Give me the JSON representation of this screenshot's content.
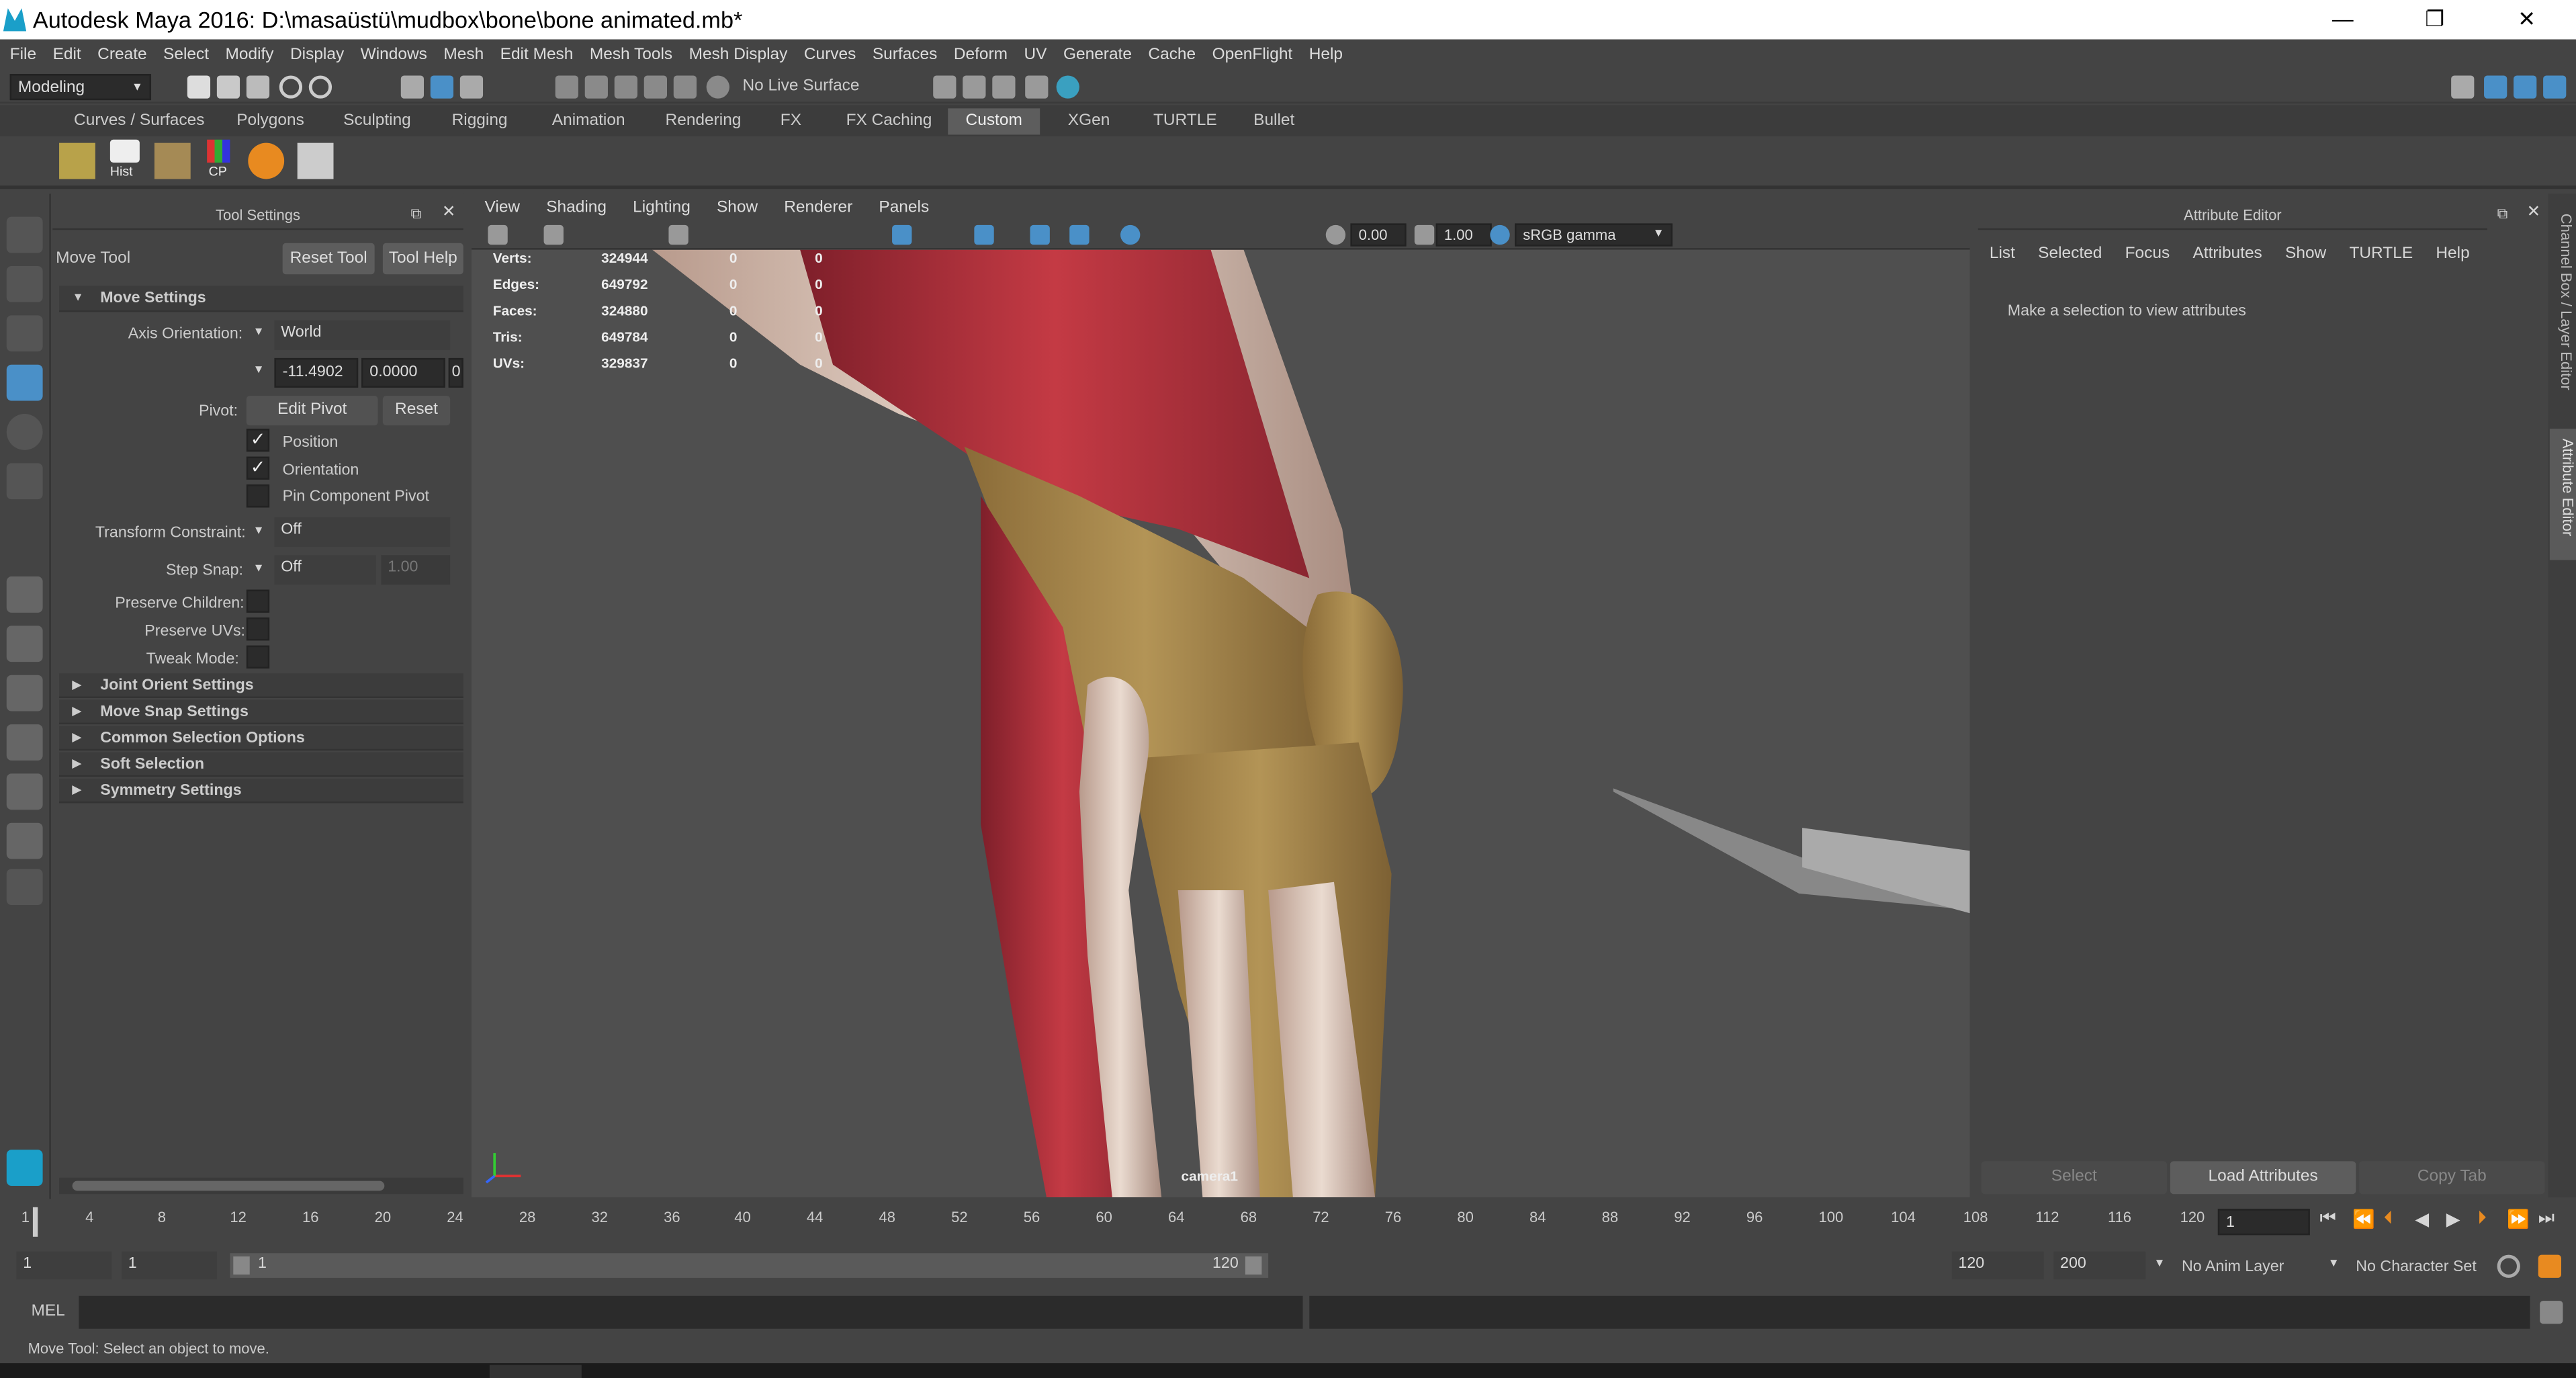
{
  "window": {
    "title": "Autodesk Maya 2016: D:\\masaüstü\\mudbox\\bone\\bone animated.mb*",
    "minimize": "—",
    "restore": "❐",
    "close": "✕"
  },
  "menubar": {
    "items": [
      "File",
      "Edit",
      "Create",
      "Select",
      "Modify",
      "Display",
      "Windows",
      "Mesh",
      "Edit Mesh",
      "Mesh Tools",
      "Mesh Display",
      "Curves",
      "Surfaces",
      "Deform",
      "UV",
      "Generate",
      "Cache",
      "OpenFlight",
      "Help"
    ]
  },
  "statusline": {
    "mode": "Modeling",
    "live_surface": "No Live Surface"
  },
  "shelf": {
    "tabs": [
      "Curves / Surfaces",
      "Polygons",
      "Sculpting",
      "Rigging",
      "Animation",
      "Rendering",
      "FX",
      "FX Caching",
      "Custom",
      "XGen",
      "TURTLE",
      "Bullet"
    ],
    "active_tab": "Custom",
    "icons": [
      {
        "name": "hist",
        "label": "Hist"
      },
      {
        "name": "cp",
        "label": "CP"
      }
    ]
  },
  "tool_settings": {
    "panel_title": "Tool Settings",
    "tool_name": "Move Tool",
    "reset_tool": "Reset Tool",
    "tool_help": "Tool Help",
    "move_settings": "Move Settings",
    "axis_orientation_label": "Axis Orientation:",
    "axis_orientation_value": "World",
    "xyz": [
      "-11.4902",
      "0.0000",
      "0"
    ],
    "pivot_label": "Pivot:",
    "edit_pivot": "Edit Pivot",
    "reset": "Reset",
    "position": "Position",
    "orientation": "Orientation",
    "pin_component_pivot": "Pin Component Pivot",
    "transform_constraint_label": "Transform Constraint:",
    "transform_constraint_value": "Off",
    "step_snap_label": "Step Snap:",
    "step_snap_value": "Off",
    "step_snap_amount": "1.00",
    "preserve_children": "Preserve Children:",
    "preserve_uvs": "Preserve UVs:",
    "tweak_mode": "Tweak Mode:",
    "sections": [
      "Joint Orient Settings",
      "Move Snap Settings",
      "Common Selection Options",
      "Soft Selection",
      "Symmetry Settings"
    ]
  },
  "viewport": {
    "menus": [
      "View",
      "Shading",
      "Lighting",
      "Show",
      "Renderer",
      "Panels"
    ],
    "exposure": "0.00",
    "gamma": "1.00",
    "color_space": "sRGB gamma",
    "hud": [
      {
        "label": "Verts:",
        "value": "324944",
        "sel": "0",
        "comp": "0"
      },
      {
        "label": "Edges:",
        "value": "649792",
        "sel": "0",
        "comp": "0"
      },
      {
        "label": "Faces:",
        "value": "324880",
        "sel": "0",
        "comp": "0"
      },
      {
        "label": "Tris:",
        "value": "649784",
        "sel": "0",
        "comp": "0"
      },
      {
        "label": "UVs:",
        "value": "329837",
        "sel": "0",
        "comp": "0"
      }
    ],
    "camera": "camera1"
  },
  "attribute_editor": {
    "title": "Attribute Editor",
    "menus": [
      "List",
      "Selected",
      "Focus",
      "Attributes",
      "Show",
      "TURTLE",
      "Help"
    ],
    "message": "Make a selection to view attributes",
    "select": "Select",
    "load_attributes": "Load Attributes",
    "copy_tab": "Copy Tab"
  },
  "sidebar_tabs": [
    "Channel Box / Layer Editor",
    "Attribute Editor"
  ],
  "timeline": {
    "ticks": [
      "1",
      "4",
      "8",
      "12",
      "16",
      "20",
      "24",
      "28",
      "32",
      "36",
      "40",
      "44",
      "48",
      "52",
      "56",
      "60",
      "64",
      "68",
      "72",
      "76",
      "80",
      "84",
      "88",
      "92",
      "96",
      "100",
      "104",
      "108",
      "112",
      "116",
      "120"
    ],
    "current_frame": "1"
  },
  "range": {
    "start": "1",
    "playback_start": "1",
    "slider_start": "1",
    "slider_end": "120",
    "playback_end": "120",
    "end": "200",
    "anim_layer": "No Anim Layer",
    "character_set": "No Character Set"
  },
  "command": {
    "label": "MEL"
  },
  "help_line": "Move Tool: Select an object to move.",
  "colors": {
    "accent": "#5d5d5d",
    "highlight": "#4a90c8",
    "muscle": "#b3323a",
    "bone": "#a8864a"
  }
}
